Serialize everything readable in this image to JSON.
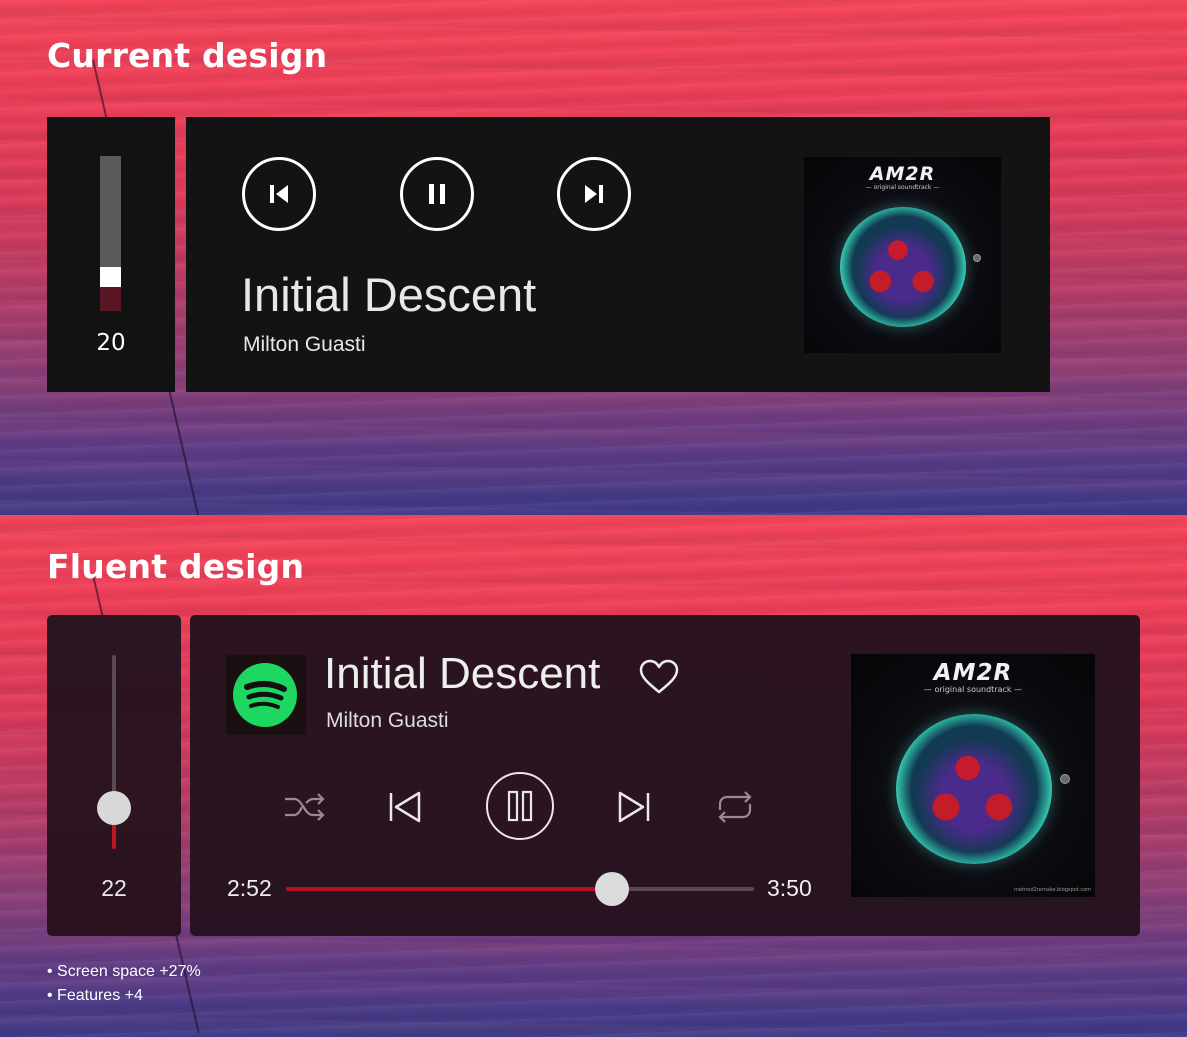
{
  "current": {
    "heading": "Current design",
    "volume": {
      "value": "20",
      "level": 0.2
    },
    "controls": {
      "previous_icon": "skip-previous-icon",
      "pause_icon": "pause-icon",
      "next_icon": "skip-next-icon"
    },
    "track": {
      "title": "Initial Descent",
      "artist": "Milton Guasti"
    },
    "album": {
      "logo": "AM2R",
      "subtitle": "— original soundtrack —"
    }
  },
  "fluent": {
    "heading": "Fluent design",
    "volume": {
      "value": "22",
      "level": 0.22
    },
    "source_icon": "spotify-icon",
    "track": {
      "title": "Initial Descent",
      "artist": "Milton Guasti"
    },
    "favorite_icon": "heart-icon",
    "controls": {
      "shuffle_icon": "shuffle-icon",
      "previous_icon": "skip-previous-icon",
      "pause_icon": "pause-icon",
      "next_icon": "skip-next-icon",
      "repeat_icon": "repeat-icon"
    },
    "progress": {
      "elapsed": "2:52",
      "total": "3:50",
      "fraction": 0.696
    },
    "album": {
      "logo": "AM2R",
      "subtitle": "— original soundtrack —",
      "site": "metroid2remake.blogspot.com"
    },
    "colors": {
      "accent": "#b51020",
      "spotify": "#1ed760"
    }
  },
  "notes": [
    "• Screen space +27%",
    "• Features +4"
  ]
}
